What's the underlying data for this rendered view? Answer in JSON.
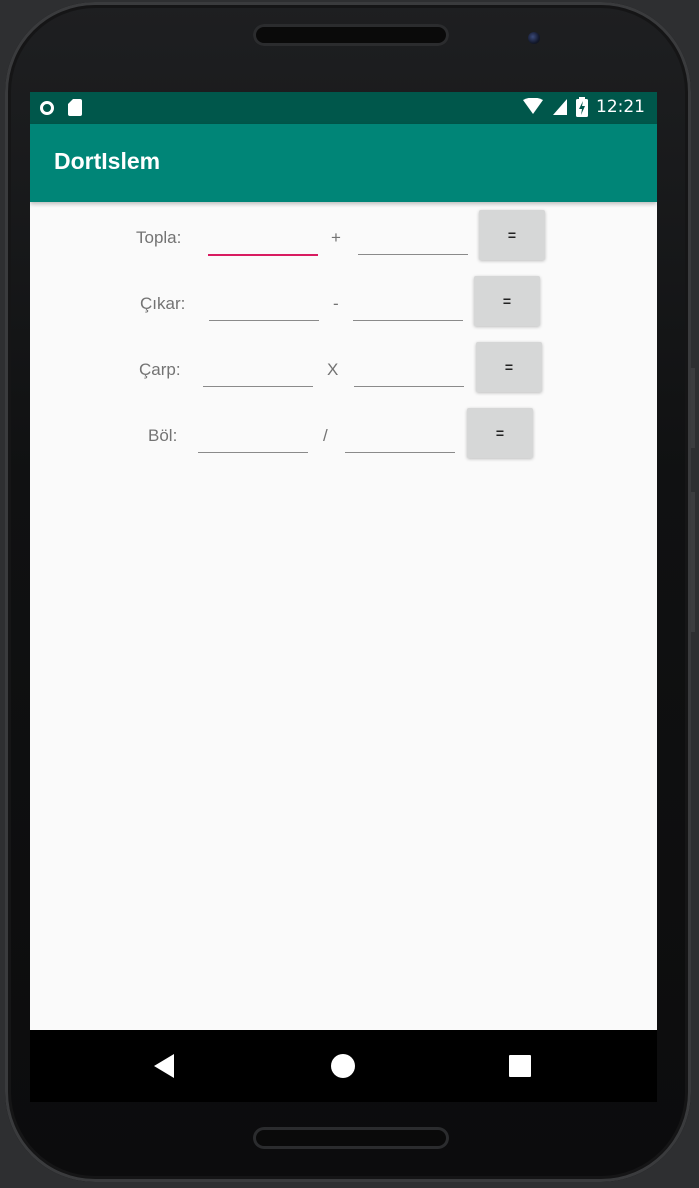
{
  "status_bar": {
    "time": "12:21",
    "icons": [
      "ring-icon",
      "sd-card-icon",
      "wifi-icon",
      "signal-icon",
      "battery-charging-icon"
    ]
  },
  "app_bar": {
    "title": "DortIslem"
  },
  "rows": [
    {
      "label": "Topla:",
      "operator": "+",
      "button": "="
    },
    {
      "label": "Çıkar:",
      "operator": "-",
      "button": "="
    },
    {
      "label": "Çarp:",
      "operator": "X",
      "button": "="
    },
    {
      "label": "Böl:",
      "operator": "/",
      "button": "="
    }
  ],
  "colors": {
    "status_bar": "#00574b",
    "app_bar": "#008577",
    "accent": "#d81b60"
  },
  "nav_bar": {
    "icons": [
      "back-icon",
      "home-icon",
      "recents-icon"
    ]
  }
}
